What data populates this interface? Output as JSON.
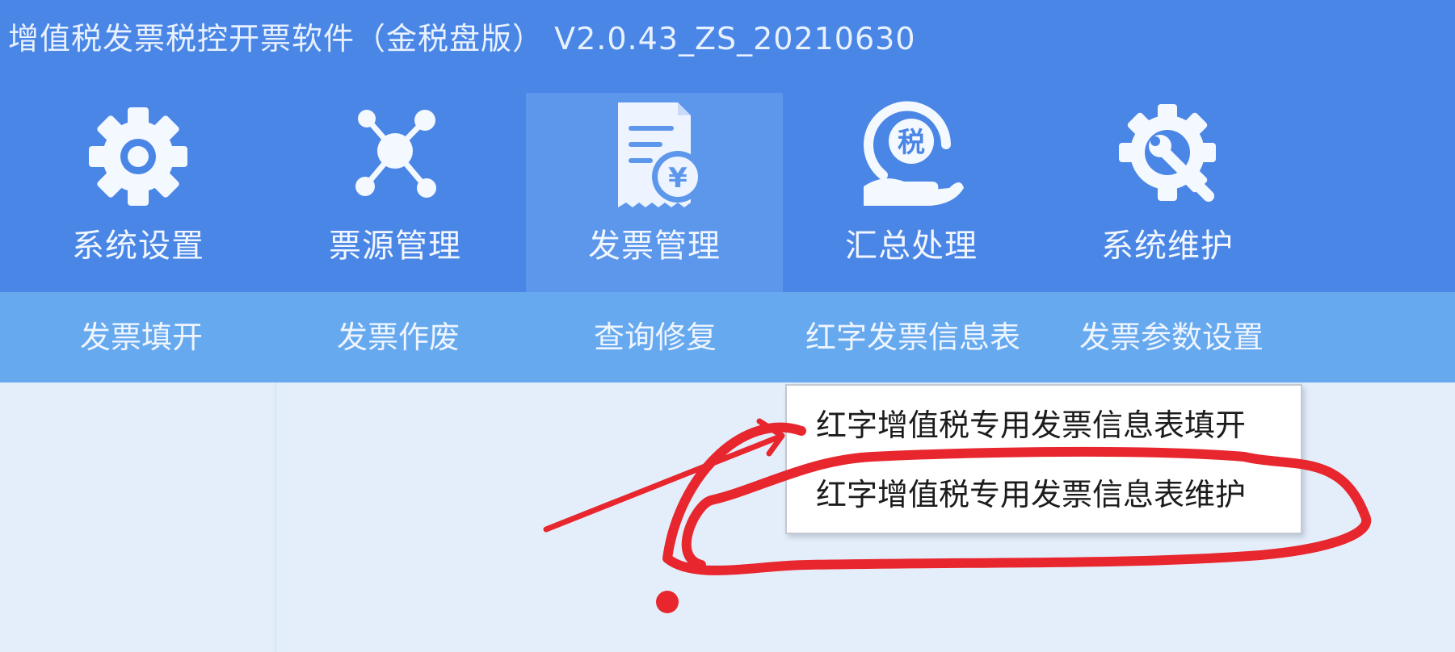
{
  "window": {
    "title": "增值税发票税控开票软件（金税盘版） V2.0.43_ZS_20210630"
  },
  "toolbar": {
    "items": [
      {
        "label": "系统设置",
        "icon": "gear-icon"
      },
      {
        "label": "票源管理",
        "icon": "network-icon"
      },
      {
        "label": "发票管理",
        "icon": "invoice-yuan-icon"
      },
      {
        "label": "汇总处理",
        "icon": "tax-hand-icon"
      },
      {
        "label": "系统维护",
        "icon": "wrench-gear-icon"
      }
    ],
    "active_index": 2
  },
  "submenu": {
    "items": [
      {
        "label": "发票填开"
      },
      {
        "label": "发票作废"
      },
      {
        "label": "查询修复"
      },
      {
        "label": "红字发票信息表"
      },
      {
        "label": "发票参数设置"
      }
    ],
    "open_index": 3
  },
  "dropdown": {
    "items": [
      {
        "label": "红字增值税专用发票信息表填开"
      },
      {
        "label": "红字增值税专用发票信息表维护"
      }
    ]
  },
  "icon_glyphs": {
    "tax": "税",
    "yuan": "¥"
  },
  "colors": {
    "header": "#4a86e6",
    "active_tab": "#5c97ec",
    "subbar": "#66a9ef",
    "content": "#e4eefa",
    "annotation": "#e8262e"
  }
}
